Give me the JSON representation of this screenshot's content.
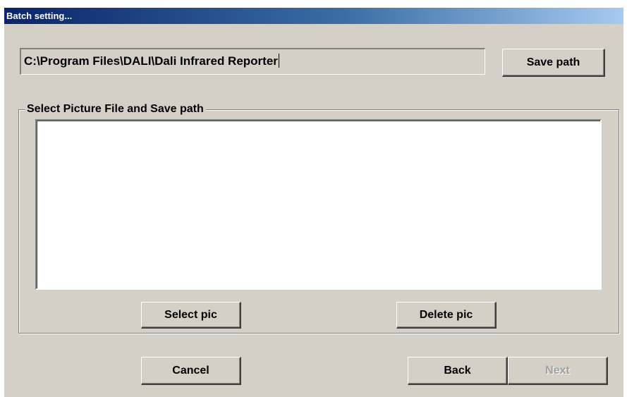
{
  "window": {
    "title": "Batch setting..."
  },
  "path": {
    "value": "C:\\Program Files\\DALI\\Dali Infrared Reporter"
  },
  "buttons": {
    "save_path": "Save path",
    "select_pic": "Select pic",
    "delete_pic": "Delete pic",
    "cancel": "Cancel",
    "back": "Back",
    "next": "Next"
  },
  "group": {
    "label": "Select Picture File and Save path"
  },
  "picture_list": {
    "items": []
  }
}
